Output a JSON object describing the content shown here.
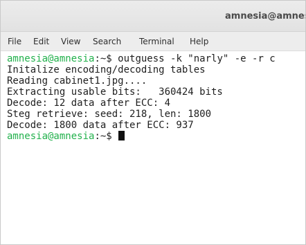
{
  "window": {
    "title": "amnesia@amnesia"
  },
  "menu": {
    "file": "File",
    "edit": "Edit",
    "view": "View",
    "search": "Search",
    "terminal": "Terminal",
    "help": "Help"
  },
  "terminal": {
    "prompt": "amnesia@amnesia",
    "prompt_suffix": ":~$ ",
    "command": "outguess -k \"narly\" -e -r c",
    "output": [
      "Initalize encoding/decoding tables",
      "Reading cabinet1.jpg....",
      "Extracting usable bits:   360424 bits",
      "Decode: 12 data after ECC: 4",
      "Steg retrieve: seed: 218, len: 1800",
      "Decode: 1800 data after ECC: 937"
    ]
  },
  "colors": {
    "prompt": "#22b14c",
    "text": "#1e1e1e",
    "background": "#ffffff"
  }
}
